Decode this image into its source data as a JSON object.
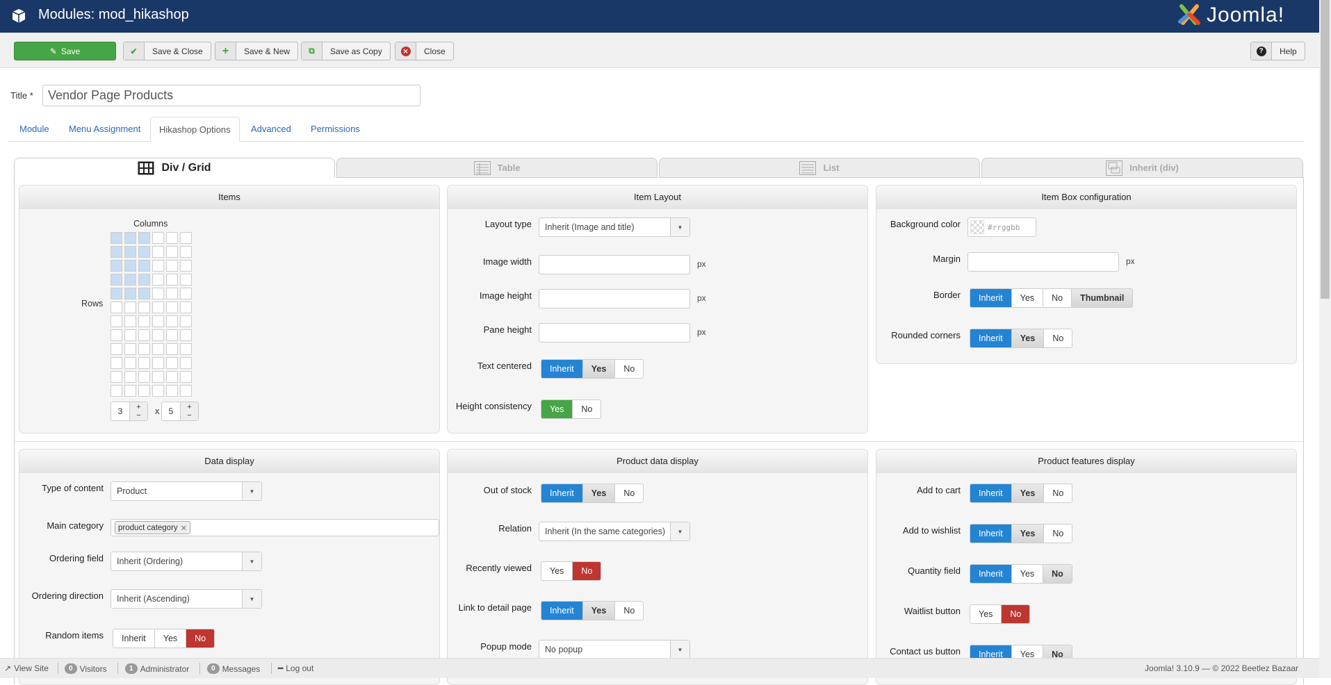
{
  "header": {
    "title": "Modules: mod_hikashop",
    "logo_text": "Joomla!"
  },
  "toolbar": {
    "save": "Save",
    "save_close": "Save & Close",
    "save_new": "Save & New",
    "save_copy": "Save as Copy",
    "close": "Close",
    "help": "Help"
  },
  "title_field": {
    "label": "Title *",
    "value": "Vendor Page Products"
  },
  "tabs": [
    "Module",
    "Menu Assignment",
    "Hikashop Options",
    "Advanced",
    "Permissions"
  ],
  "active_tab": "Hikashop Options",
  "layout_tabs": [
    "Div / Grid",
    "Table",
    "List",
    "Inherit (div)"
  ],
  "active_layout_tab": "Div / Grid",
  "panels": {
    "items": {
      "title": "Items",
      "columns_label": "Columns",
      "rows_label": "Rows",
      "columns": 3,
      "rows": 5,
      "sep": "x",
      "plus": "+",
      "minus": "−"
    },
    "item_layout": {
      "title": "Item Layout",
      "rows": [
        {
          "type": "select",
          "label": "Layout type",
          "value": "Inherit (Image and title)"
        },
        {
          "type": "text",
          "label": "Image width",
          "value": "",
          "unit": "px"
        },
        {
          "type": "text",
          "label": "Image height",
          "value": "",
          "unit": "px"
        },
        {
          "type": "text",
          "label": "Pane height",
          "value": "",
          "unit": "px"
        },
        {
          "type": "toggle",
          "label": "Text centered",
          "options": [
            {
              "label": "Inherit",
              "state": "primary"
            },
            {
              "label": "Yes",
              "state": "inherited"
            },
            {
              "label": "No",
              "state": ""
            }
          ]
        },
        {
          "type": "toggle",
          "label": "Height consistency",
          "options": [
            {
              "label": "Yes",
              "state": "success"
            },
            {
              "label": "No",
              "state": ""
            }
          ]
        }
      ]
    },
    "item_box": {
      "title": "Item Box configuration",
      "rows": [
        {
          "type": "color",
          "label": "Background color",
          "placeholder": "#rrggbb"
        },
        {
          "type": "text",
          "label": "Margin",
          "value": "",
          "unit": "px"
        },
        {
          "type": "toggle",
          "label": "Border",
          "options": [
            {
              "label": "Inherit",
              "state": "primary"
            },
            {
              "label": "Yes",
              "state": ""
            },
            {
              "label": "No",
              "state": ""
            },
            {
              "label": "Thumbnail",
              "state": "inherited"
            }
          ]
        },
        {
          "type": "toggle",
          "label": "Rounded corners",
          "options": [
            {
              "label": "Inherit",
              "state": "primary"
            },
            {
              "label": "Yes",
              "state": "inherited"
            },
            {
              "label": "No",
              "state": ""
            }
          ]
        }
      ]
    },
    "data_display": {
      "title": "Data display",
      "rows": [
        {
          "type": "select",
          "label": "Type of content",
          "value": "Product"
        },
        {
          "type": "tags",
          "label": "Main category",
          "tags": [
            "product category"
          ]
        },
        {
          "type": "select",
          "label": "Ordering field",
          "value": "Inherit (Ordering)"
        },
        {
          "type": "select",
          "label": "Ordering direction",
          "value": "Inherit (Ascending)"
        },
        {
          "type": "toggle",
          "label": "Random items",
          "options": [
            {
              "label": "Inherit",
              "state": ""
            },
            {
              "label": "Yes",
              "state": ""
            },
            {
              "label": "No",
              "state": "danger"
            }
          ]
        }
      ]
    },
    "product_data": {
      "title": "Product data display",
      "rows": [
        {
          "type": "toggle",
          "label": "Out of stock",
          "options": [
            {
              "label": "Inherit",
              "state": "primary"
            },
            {
              "label": "Yes",
              "state": "inherited"
            },
            {
              "label": "No",
              "state": ""
            }
          ]
        },
        {
          "type": "select",
          "label": "Relation",
          "value": "Inherit (In the same categories)"
        },
        {
          "type": "toggle",
          "label": "Recently viewed",
          "options": [
            {
              "label": "Yes",
              "state": ""
            },
            {
              "label": "No",
              "state": "danger"
            }
          ]
        },
        {
          "type": "toggle",
          "label": "Link to detail page",
          "options": [
            {
              "label": "Inherit",
              "state": "primary"
            },
            {
              "label": "Yes",
              "state": "inherited"
            },
            {
              "label": "No",
              "state": ""
            }
          ]
        },
        {
          "type": "select",
          "label": "Popup mode",
          "value": "No popup"
        }
      ]
    },
    "product_features": {
      "title": "Product features display",
      "rows": [
        {
          "type": "toggle",
          "label": "Add to cart",
          "options": [
            {
              "label": "Inherit",
              "state": "primary"
            },
            {
              "label": "Yes",
              "state": "inherited"
            },
            {
              "label": "No",
              "state": ""
            }
          ]
        },
        {
          "type": "toggle",
          "label": "Add to wishlist",
          "options": [
            {
              "label": "Inherit",
              "state": "primary"
            },
            {
              "label": "Yes",
              "state": "inherited"
            },
            {
              "label": "No",
              "state": ""
            }
          ]
        },
        {
          "type": "toggle",
          "label": "Quantity field",
          "options": [
            {
              "label": "Inherit",
              "state": "primary"
            },
            {
              "label": "Yes",
              "state": ""
            },
            {
              "label": "No",
              "state": "inherited"
            }
          ]
        },
        {
          "type": "toggle",
          "label": "Waitlist button",
          "options": [
            {
              "label": "Yes",
              "state": ""
            },
            {
              "label": "No",
              "state": "danger"
            }
          ]
        },
        {
          "type": "toggle",
          "label": "Contact us button",
          "options": [
            {
              "label": "Inherit",
              "state": "primary"
            },
            {
              "label": "Yes",
              "state": ""
            },
            {
              "label": "No",
              "state": "inherited"
            }
          ]
        }
      ]
    }
  },
  "footer": {
    "view_site": "View Site",
    "visitors_count": "0",
    "visitors": "Visitors",
    "admin_count": "1",
    "admin": "Administrator",
    "messages_count": "0",
    "messages": "Messages",
    "logout": "Log out",
    "version": "Joomla! 3.10.9 — © 2022 Beetlez Bazaar"
  },
  "colors": {
    "header": "#1a3867",
    "primary": "#2384d3",
    "success": "#46a546",
    "danger": "#bd362f"
  }
}
